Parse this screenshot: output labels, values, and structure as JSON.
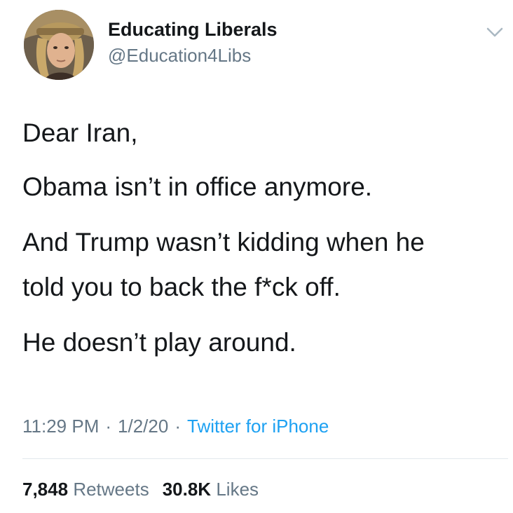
{
  "author": {
    "display_name": "Educating Liberals",
    "handle": "@Education4Libs",
    "avatar_icon": "profile-photo"
  },
  "menu": {
    "icon": "chevron-down-icon"
  },
  "tweet": {
    "lines": [
      "Dear Iran,",
      "Obama isn’t in office anymore.",
      "And Trump wasn’t kidding when he",
      "told you to back the f*ck off.",
      "He doesn’t play around."
    ],
    "time": "11:29 PM",
    "date": "1/2/20",
    "separator": "·",
    "source": "Twitter for iPhone"
  },
  "stats": {
    "retweets_count": "7,848",
    "retweets_label": "Retweets",
    "likes_count": "30.8K",
    "likes_label": "Likes"
  },
  "colors": {
    "text": "#14171a",
    "secondary": "#657786",
    "link": "#1da1f2",
    "divider": "#e1e8ed"
  }
}
